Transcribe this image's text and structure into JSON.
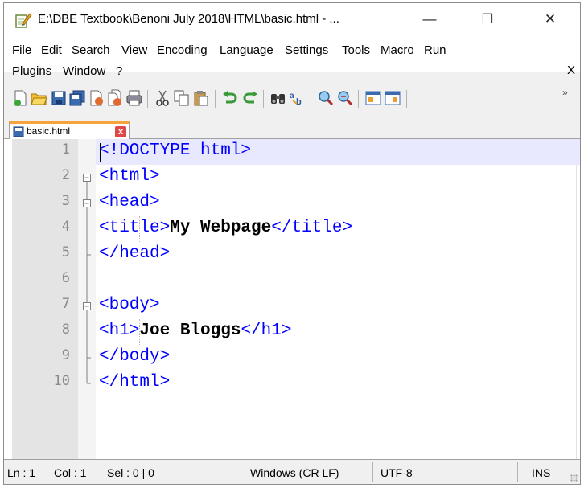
{
  "window": {
    "title": "E:\\DBE Textbook\\Benoni July 2018\\HTML\\basic.html - ...",
    "min_glyph": "—",
    "max_glyph": "☐",
    "close_glyph": "✕"
  },
  "menu": {
    "items": [
      "File",
      "Edit",
      "Search",
      "View",
      "Encoding",
      "Language",
      "Settings",
      "Tools",
      "Macro",
      "Run",
      "Plugins",
      "Window",
      "?"
    ],
    "close_x": "X"
  },
  "toolbar": {
    "buttons": [
      "new-file-icon",
      "open-file-icon",
      "save-icon",
      "save-all-icon",
      "close-icon",
      "close-all-icon",
      "print-icon",
      "cut-icon",
      "copy-icon",
      "paste-icon",
      "undo-icon",
      "redo-icon",
      "find-icon",
      "replace-icon",
      "zoom-in-icon",
      "zoom-out-icon",
      "sync-vertical-icon",
      "sync-horizontal-icon"
    ],
    "more": "»"
  },
  "tab": {
    "label": "basic.html",
    "close": "x"
  },
  "editor": {
    "lines": [
      {
        "num": "1",
        "tag_a": "<!DOCTYPE html>",
        "text": "",
        "tag_b": ""
      },
      {
        "num": "2",
        "tag_a": "<html>",
        "text": "",
        "tag_b": ""
      },
      {
        "num": "3",
        "tag_a": "<head>",
        "text": "",
        "tag_b": ""
      },
      {
        "num": "4",
        "tag_a": "<title>",
        "text": "My Webpage",
        "tag_b": "</title>"
      },
      {
        "num": "5",
        "tag_a": "</head>",
        "text": "",
        "tag_b": ""
      },
      {
        "num": "6",
        "tag_a": "",
        "text": "",
        "tag_b": ""
      },
      {
        "num": "7",
        "tag_a": "<body>",
        "text": "",
        "tag_b": ""
      },
      {
        "num": "8",
        "tag_a": "<h1>",
        "text": "Joe Bloggs",
        "tag_b": "</h1>"
      },
      {
        "num": "9",
        "tag_a": "</body>",
        "text": "",
        "tag_b": ""
      },
      {
        "num": "10",
        "tag_a": "</html>",
        "text": "",
        "tag_b": ""
      }
    ]
  },
  "status": {
    "ln": "Ln : 1",
    "col": "Col : 1",
    "sel": "Sel : 0 | 0",
    "eol": "Windows (CR LF)",
    "encoding": "UTF-8",
    "mode": "INS"
  },
  "colors": {
    "tag": "#0000ff",
    "text": "#000000",
    "current_line": "#e8e8ff",
    "tab_accent": "#f7a33c"
  }
}
